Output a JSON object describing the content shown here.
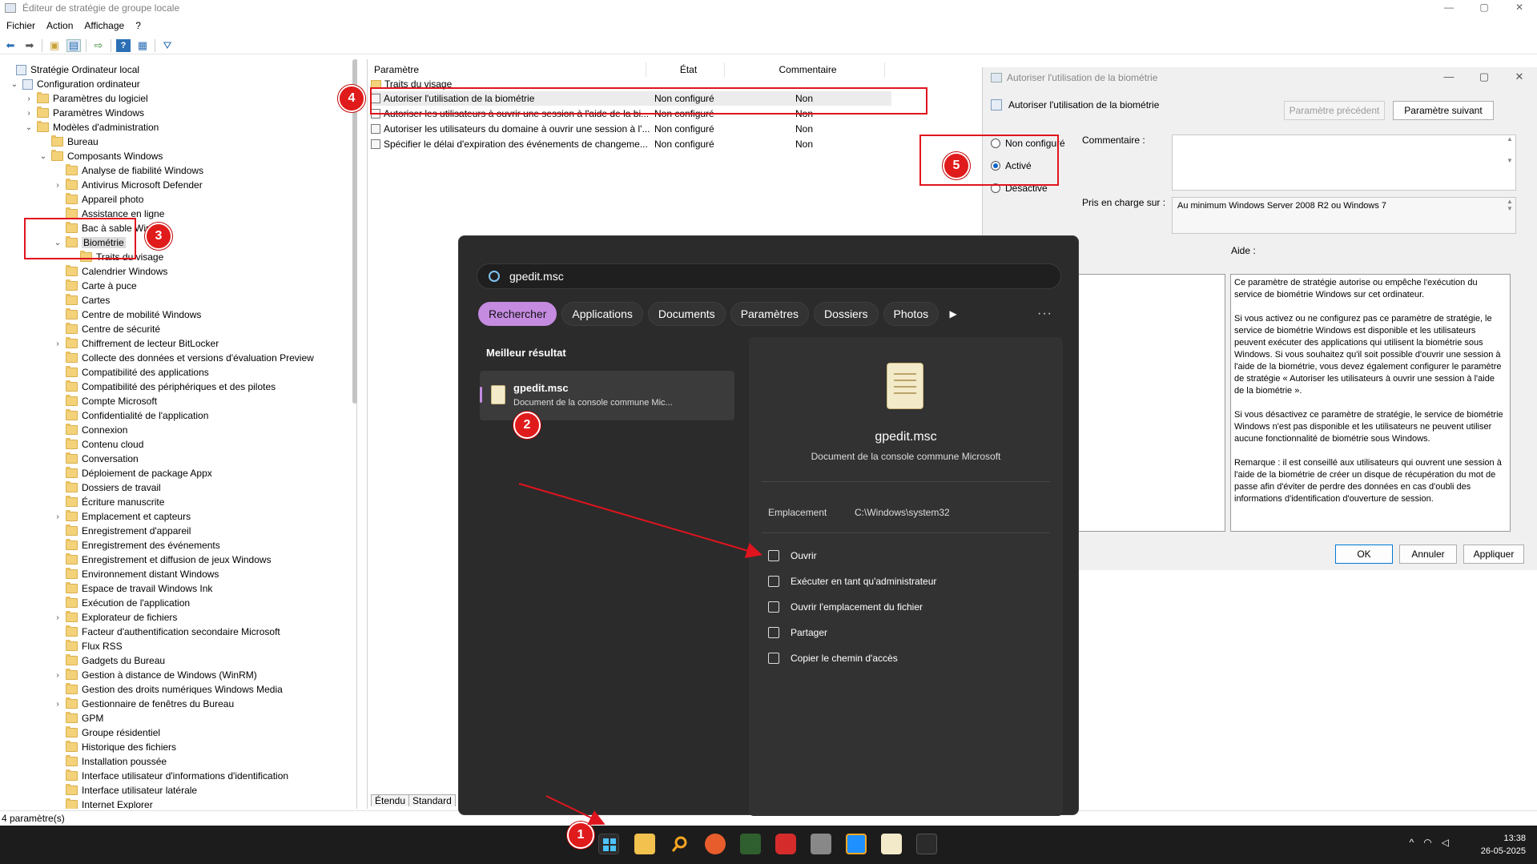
{
  "window": {
    "title": "Éditeur de stratégie de groupe locale",
    "controls": [
      "—",
      "▢",
      "✕"
    ]
  },
  "menu": [
    "Fichier",
    "Action",
    "Affichage",
    "?"
  ],
  "tree": [
    {
      "label": "Stratégie Ordinateur local",
      "chev": "",
      "icon": "policy",
      "indent": 0
    },
    {
      "label": "Configuration ordinateur",
      "chev": "⌄",
      "icon": "policy",
      "indent": 1
    },
    {
      "label": "Paramètres du logiciel",
      "chev": "›",
      "icon": "folder",
      "indent": 2
    },
    {
      "label": "Paramètres Windows",
      "chev": "›",
      "icon": "folder",
      "indent": 2
    },
    {
      "label": "Modèles d'administration",
      "chev": "⌄",
      "icon": "folder",
      "indent": 2
    },
    {
      "label": "Bureau",
      "chev": "",
      "icon": "folder",
      "indent": 3
    },
    {
      "label": "Composants Windows",
      "chev": "⌄",
      "icon": "folder",
      "indent": 3
    },
    {
      "label": "Analyse de fiabilité Windows",
      "chev": "",
      "icon": "folder",
      "indent": 4
    },
    {
      "label": "Antivirus Microsoft Defender",
      "chev": "›",
      "icon": "folder",
      "indent": 4
    },
    {
      "label": "Appareil photo",
      "chev": "",
      "icon": "folder",
      "indent": 4
    },
    {
      "label": "Assistance en ligne",
      "chev": "",
      "icon": "folder",
      "indent": 4
    },
    {
      "label": "Bac à sable Win",
      "chev": "",
      "icon": "folder",
      "indent": 4
    },
    {
      "label": "Biométrie",
      "chev": "⌄",
      "icon": "folder",
      "indent": 4,
      "selected": true
    },
    {
      "label": "Traits du visage",
      "chev": "",
      "icon": "folder",
      "indent": 5
    },
    {
      "label": "Calendrier Windows",
      "chev": "",
      "icon": "folder",
      "indent": 4
    },
    {
      "label": "Carte à puce",
      "chev": "",
      "icon": "folder",
      "indent": 4
    },
    {
      "label": "Cartes",
      "chev": "",
      "icon": "folder",
      "indent": 4
    },
    {
      "label": "Centre de mobilité Windows",
      "chev": "",
      "icon": "folder",
      "indent": 4
    },
    {
      "label": "Centre de sécurité",
      "chev": "",
      "icon": "folder",
      "indent": 4
    },
    {
      "label": "Chiffrement de lecteur BitLocker",
      "chev": "›",
      "icon": "folder",
      "indent": 4
    },
    {
      "label": "Collecte des données et versions d'évaluation Preview",
      "chev": "",
      "icon": "folder",
      "indent": 4
    },
    {
      "label": "Compatibilité des applications",
      "chev": "",
      "icon": "folder",
      "indent": 4
    },
    {
      "label": "Compatibilité des périphériques et des pilotes",
      "chev": "",
      "icon": "folder",
      "indent": 4
    },
    {
      "label": "Compte Microsoft",
      "chev": "",
      "icon": "folder",
      "indent": 4
    },
    {
      "label": "Confidentialité de l'application",
      "chev": "",
      "icon": "folder",
      "indent": 4
    },
    {
      "label": "Connexion",
      "chev": "",
      "icon": "folder",
      "indent": 4
    },
    {
      "label": "Contenu cloud",
      "chev": "",
      "icon": "folder",
      "indent": 4
    },
    {
      "label": "Conversation",
      "chev": "",
      "icon": "folder",
      "indent": 4
    },
    {
      "label": "Déploiement de package Appx",
      "chev": "",
      "icon": "folder",
      "indent": 4
    },
    {
      "label": "Dossiers de travail",
      "chev": "",
      "icon": "folder",
      "indent": 4
    },
    {
      "label": "Écriture manuscrite",
      "chev": "",
      "icon": "folder",
      "indent": 4
    },
    {
      "label": "Emplacement et capteurs",
      "chev": "›",
      "icon": "folder",
      "indent": 4
    },
    {
      "label": "Enregistrement d'appareil",
      "chev": "",
      "icon": "folder",
      "indent": 4
    },
    {
      "label": "Enregistrement des événements",
      "chev": "",
      "icon": "folder",
      "indent": 4
    },
    {
      "label": "Enregistrement et diffusion de jeux Windows",
      "chev": "",
      "icon": "folder",
      "indent": 4
    },
    {
      "label": "Environnement distant Windows",
      "chev": "",
      "icon": "folder",
      "indent": 4
    },
    {
      "label": "Espace de travail Windows Ink",
      "chev": "",
      "icon": "folder",
      "indent": 4
    },
    {
      "label": "Exécution de l'application",
      "chev": "",
      "icon": "folder",
      "indent": 4
    },
    {
      "label": "Explorateur de fichiers",
      "chev": "›",
      "icon": "folder",
      "indent": 4
    },
    {
      "label": "Facteur d'authentification secondaire Microsoft",
      "chev": "",
      "icon": "folder",
      "indent": 4
    },
    {
      "label": "Flux RSS",
      "chev": "",
      "icon": "folder",
      "indent": 4
    },
    {
      "label": "Gadgets du Bureau",
      "chev": "",
      "icon": "folder",
      "indent": 4
    },
    {
      "label": "Gestion à distance de Windows (WinRM)",
      "chev": "›",
      "icon": "folder",
      "indent": 4
    },
    {
      "label": "Gestion des droits numériques Windows Media",
      "chev": "",
      "icon": "folder",
      "indent": 4
    },
    {
      "label": "Gestionnaire de fenêtres du Bureau",
      "chev": "›",
      "icon": "folder",
      "indent": 4
    },
    {
      "label": "GPM",
      "chev": "",
      "icon": "folder",
      "indent": 4
    },
    {
      "label": "Groupe résidentiel",
      "chev": "",
      "icon": "folder",
      "indent": 4
    },
    {
      "label": "Historique des fichiers",
      "chev": "",
      "icon": "folder",
      "indent": 4
    },
    {
      "label": "Installation poussée",
      "chev": "",
      "icon": "folder",
      "indent": 4
    },
    {
      "label": "Interface utilisateur d'informations d'identification",
      "chev": "",
      "icon": "folder",
      "indent": 4
    },
    {
      "label": "Interface utilisateur latérale",
      "chev": "",
      "icon": "folder",
      "indent": 4
    },
    {
      "label": "Internet Explorer",
      "chev": "",
      "icon": "folder",
      "indent": 4
    }
  ],
  "list": {
    "headers": [
      "Paramètre",
      "État",
      "Commentaire"
    ],
    "folder_row": "Traits du visage",
    "rows": [
      {
        "name": "Autoriser l'utilisation de la biométrie",
        "state": "Non configuré",
        "comment": "Non"
      },
      {
        "name": "Autoriser les utilisateurs à ouvrir une session à l'aide de la bi...",
        "state": "Non configuré",
        "comment": "Non"
      },
      {
        "name": "Autoriser les utilisateurs du domaine à ouvrir une session à l'...",
        "state": "Non configuré",
        "comment": "Non"
      },
      {
        "name": "Spécifier le délai d'expiration des événements de changeme...",
        "state": "Non configuré",
        "comment": "Non"
      }
    ],
    "tabs": [
      "Étendu",
      "Standard"
    ]
  },
  "status": "4 paramètre(s)",
  "dialog": {
    "title": "Autoriser l'utilisation de la biométrie",
    "subtitle": "Autoriser l'utilisation de la biométrie",
    "prev_btn": "Paramètre précédent",
    "next_btn": "Paramètre suivant",
    "radios": [
      "Non configuré",
      "Activé",
      "Désactivé"
    ],
    "selected_radio": "Activé",
    "comment_label": "Commentaire :",
    "supported_label": "Pris en charge sur :",
    "supported_value": "Au minimum Windows Server 2008 R2 ou Windows 7",
    "help_label": "Aide :",
    "help_text": "Ce paramètre de stratégie autorise ou empêche l'exécution du service de biométrie Windows sur cet ordinateur.\n\nSi vous activez ou ne configurez pas ce paramètre de stratégie, le service de biométrie Windows est disponible et les utilisateurs peuvent exécuter des applications qui utilisent la biométrie sous Windows. Si vous souhaitez qu'il soit possible d'ouvrir une session à l'aide de la biométrie, vous devez également configurer le paramètre de stratégie « Autoriser les utilisateurs à ouvrir une session à l'aide de la biométrie ».\n\nSi vous désactivez ce paramètre de stratégie, le service de biométrie Windows n'est pas disponible et les utilisateurs ne peuvent utiliser aucune fonctionnalité de biométrie sous Windows.\n\nRemarque : il est conseillé aux utilisateurs qui ouvrent une session à l'aide de la biométrie de créer un disque de récupération du mot de passe afin d'éviter de perdre des données en cas d'oubli des informations d'identification d'ouverture de session.",
    "ok": "OK",
    "cancel": "Annuler",
    "apply": "Appliquer"
  },
  "start": {
    "query": "gpedit.msc",
    "filters": [
      "Rechercher",
      "Applications",
      "Documents",
      "Paramètres",
      "Dossiers",
      "Photos"
    ],
    "play": "▶",
    "more": "···",
    "best_label": "Meilleur résultat",
    "best_name": "gpedit.msc",
    "best_desc": "Document de la console commune Mic...",
    "detail_name": "gpedit.msc",
    "detail_desc": "Document de la console commune Microsoft",
    "location_key": "Emplacement",
    "location_value": "C:\\Windows\\system32",
    "actions": [
      "Ouvrir",
      "Exécuter en tant qu'administrateur",
      "Ouvrir l'emplacement du fichier",
      "Partager",
      "Copier le chemin d'accès"
    ]
  },
  "tray": {
    "time": "13:38",
    "date": "26-05-2025",
    "icons": [
      "^",
      "wifi",
      "volume"
    ]
  },
  "badges": [
    "1",
    "2",
    "3",
    "4",
    "5"
  ],
  "colors": {
    "annotation_red": "#e0141e",
    "start_accent": "#c48be0",
    "start_bg": "#2b2b2b",
    "taskbar_bg": "#1c1c1c"
  }
}
